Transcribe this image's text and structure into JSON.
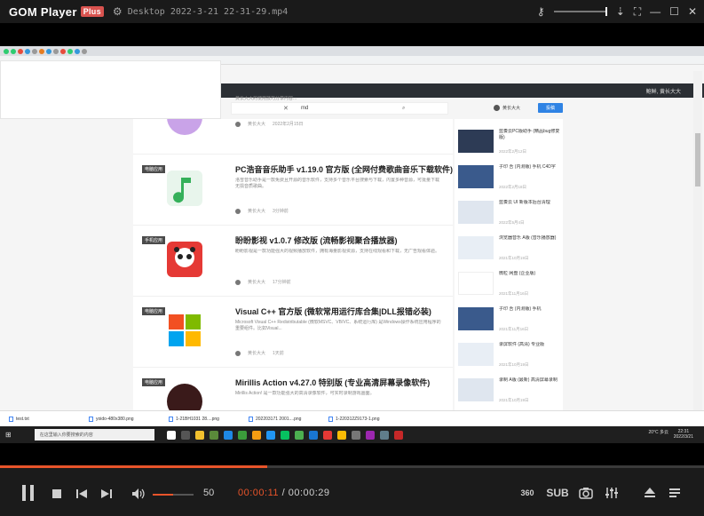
{
  "app": {
    "logo": "GOM Player",
    "plus_badge": "Plus",
    "window_title": "Desktop 2022-3-21 22-31-29.mp4"
  },
  "video": {
    "site_nav_text": "鲍鲜, 黄长大大",
    "search": {
      "query": "md"
    },
    "user_name": "黄长大大",
    "upload_button": "投稿",
    "articles": [
      {
        "badge": "",
        "title": "",
        "desc": "黄长大大的使用技巧分享内容...",
        "author": "黄长大大",
        "time": "2022年2月15日",
        "icon_color": "#c9a3e8"
      },
      {
        "badge": "电脑应用",
        "title": "PC浩音音乐助手 v1.19.0 官方版 (全网付费歌曲音乐下载软件)",
        "desc": "洛雪音乐助手是一款免费且开源的音乐软件，支持多个音乐平台搜索与下载，内置多种音源，可批量下载无损音质歌曲。",
        "author": "黄长大大",
        "time": "3分钟前",
        "icon_color": "#35b05a"
      },
      {
        "badge": "手机应用",
        "title": "盼盼影视 v1.0.7 修改版 (流畅影视聚合播放器)",
        "desc": "盼盼影视是一款功能强大的视频播放软件，拥有海量影视资源，支持在线观看和下载，无广告观看体验。",
        "author": "黄长大大",
        "time": "17分钟前",
        "icon_color": "#e53935"
      },
      {
        "badge": "电脑应用",
        "title": "Visual C++ 官方版 (微软常用运行库合集|DLL报错必装)",
        "desc": "Microsoft Visual C++ Redistributable (微软MSVC、VB/VC、系统运行库) 是Windows操作系统应用程序的重要组件。比如Visual...",
        "author": "黄长大大",
        "time": "1天前",
        "icon_color": "#f25022"
      },
      {
        "badge": "电脑应用",
        "title": "Mirillis Action v4.27.0 特别版 (专业高清屏幕录像软件)",
        "desc": "Mirillis Action! 是一款功能强大的高清录像软件，可实时录制游戏画面。",
        "author": "",
        "time": "",
        "icon_color": "#c0392b"
      }
    ],
    "sidebar": [
      {
        "text": "蓝奏云PC版助手 (精品bug修复版)",
        "date": "2022年2月12日",
        "thumb": "#2d3b55"
      },
      {
        "text": "子印 吾 (内测版) 手机 C4D字",
        "date": "2022年2月18日",
        "thumb": "#3a5a8c"
      },
      {
        "text": "蓝奏云 UI 新版本后台清理",
        "date": "2022年5月4日",
        "thumb": "#dfe6ef"
      },
      {
        "text": "浏览器音乐 A版 (音乐播放器)",
        "date": "2021年10月19日",
        "thumb": "#e8eef5"
      },
      {
        "text": "微粒 网盘 (企业版)",
        "date": "2021年11月16日",
        "thumb": "#ffffff"
      },
      {
        "text": "子印 吾 (内测版) 手机",
        "date": "2021年11月16日",
        "thumb": "#3a5a8c"
      },
      {
        "text": "录屏软件 (高清) 专业版",
        "date": "2021年10月19日",
        "thumb": "#e8eef5"
      },
      {
        "text": "录制 A版 (最新) 高清屏幕录制",
        "date": "2021年10月19日",
        "thumb": "#dfe6ef"
      }
    ],
    "downloads": [
      "test.txt",
      "yoido-480x380.png",
      "1-21BH1031 28....png",
      "202203171 2001....png",
      "1-220312Z9173-1.png"
    ],
    "taskbar": {
      "search_placeholder": "在这里输入你要搜索的内容",
      "weather": "20°C 多云",
      "time": "22:31",
      "date": "2022/3/21"
    }
  },
  "player": {
    "progress": 0.379,
    "volume": 50,
    "volume_label": "50",
    "current_time": "00:00:11",
    "separator": "/",
    "total_time": "00:00:29",
    "sub_label": "SUB",
    "three_sixty": "360"
  },
  "colors": {
    "accent": "#e8542a",
    "topbar": "#1a1a1a",
    "controls_bg": "#1b1b1b"
  }
}
